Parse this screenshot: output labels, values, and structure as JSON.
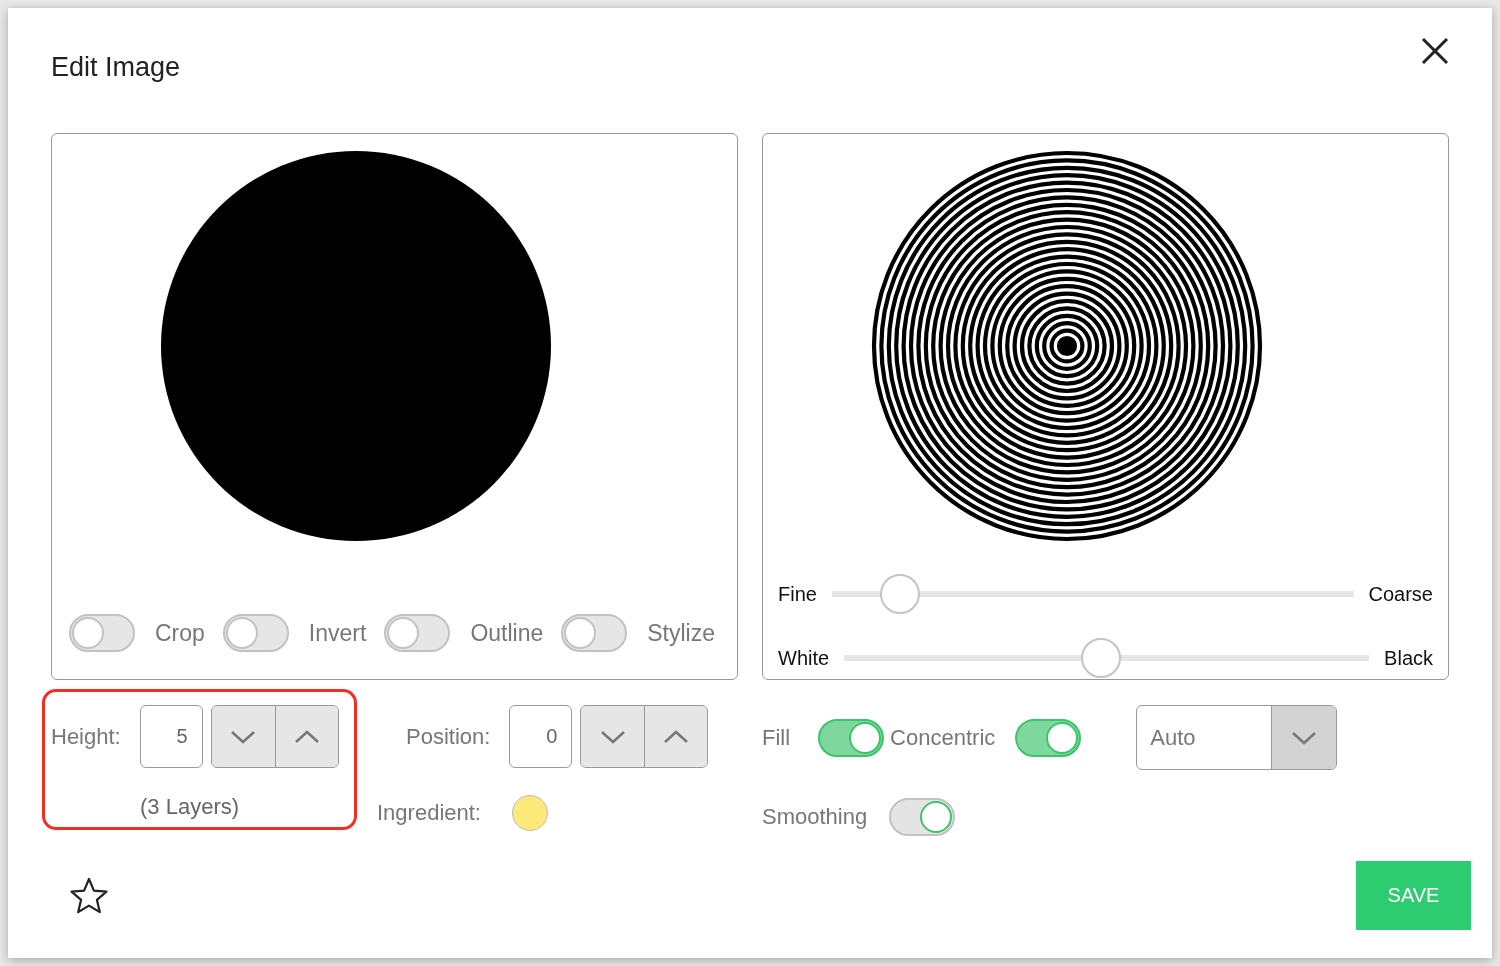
{
  "dialog": {
    "title": "Edit Image"
  },
  "source_panel": {
    "toggles": [
      {
        "label": "Crop",
        "on": false
      },
      {
        "label": "Invert",
        "on": false
      },
      {
        "label": "Outline",
        "on": false
      },
      {
        "label": "Stylize",
        "on": false
      }
    ]
  },
  "result_panel": {
    "sliders": [
      {
        "left_label": "Fine",
        "right_label": "Coarse",
        "level": 0.13
      },
      {
        "left_label": "White",
        "right_label": "Black",
        "level": 0.49
      }
    ]
  },
  "height": {
    "label": "Height:",
    "value": "5",
    "note": "(3 Layers)",
    "highlighted": true
  },
  "position": {
    "label": "Position:",
    "value": "0"
  },
  "ingredient": {
    "label": "Ingredient:",
    "color": "#fde97a"
  },
  "fill_toggles": [
    {
      "label": "Fill",
      "on": true
    },
    {
      "label": "Concentric",
      "on": true
    }
  ],
  "mode_select": {
    "value": "Auto"
  },
  "smoothing": {
    "label": "Smoothing",
    "on": true,
    "disabled": true
  },
  "favorite": {
    "starred": false
  },
  "save_button": {
    "label": "SAVE"
  }
}
